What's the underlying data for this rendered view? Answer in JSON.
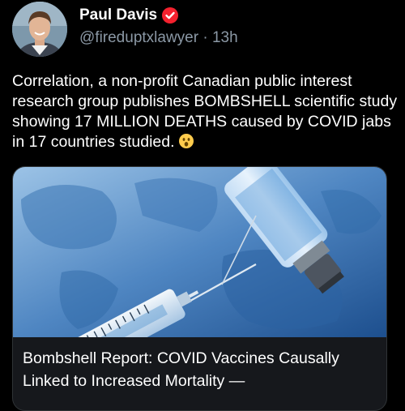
{
  "author": {
    "name": "Paul Davis",
    "handle": "@fireduptxlawyer",
    "separator": "·",
    "time": "13h",
    "verified_color": "#f4212e",
    "avatar_icon": "profile-photo"
  },
  "tweet": {
    "text": "Correlation, a non-profit Canadian public interest research group publishes BOMBSHELL scientific study showing 17 MILLION DEATHS caused by COVID jabs in 17 countries studied.",
    "emoji": "astonished-face"
  },
  "card": {
    "image_subject": "vaccine-vial-syringe-world-map",
    "title": "Bombshell Report: COVID Vaccines Causally Linked to Increased Mortality —"
  }
}
